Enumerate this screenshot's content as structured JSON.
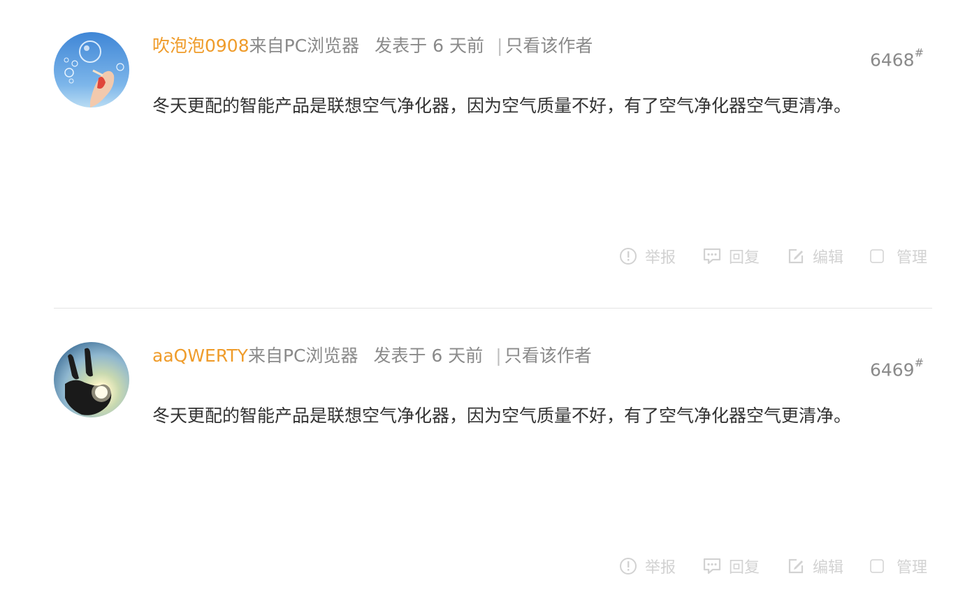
{
  "posts": [
    {
      "username": "吹泡泡0908",
      "from": "来自PC浏览器",
      "posted": "发表于 6 天前",
      "separator": "|",
      "author_only": "只看该作者",
      "floor": "6468",
      "floor_mark": "#",
      "content": "冬天更配的智能产品是联想空气净化器，因为空气质量不好，有了空气净化器空气更清净。",
      "actions": {
        "report": "举报",
        "reply": "回复",
        "edit": "编辑",
        "manage": "管理"
      }
    },
    {
      "username": "aaQWERTY",
      "from": "来自PC浏览器",
      "posted": "发表于 6 天前",
      "separator": "|",
      "author_only": "只看该作者",
      "floor": "6469",
      "floor_mark": "#",
      "content": "冬天更配的智能产品是联想空气净化器，因为空气质量不好，有了空气净化器空气更清净。",
      "actions": {
        "report": "举报",
        "reply": "回复",
        "edit": "编辑",
        "manage": "管理"
      }
    }
  ],
  "colors": {
    "username": "#ef9c2b",
    "meta": "#8a8a8a",
    "content": "#333333",
    "action": "#d2d2d2",
    "divider": "#e4e4e4"
  },
  "icons": {
    "report": "exclamation-circle-icon",
    "reply": "speech-bubble-icon",
    "edit": "pencil-square-icon",
    "manage": "checkbox-icon"
  }
}
